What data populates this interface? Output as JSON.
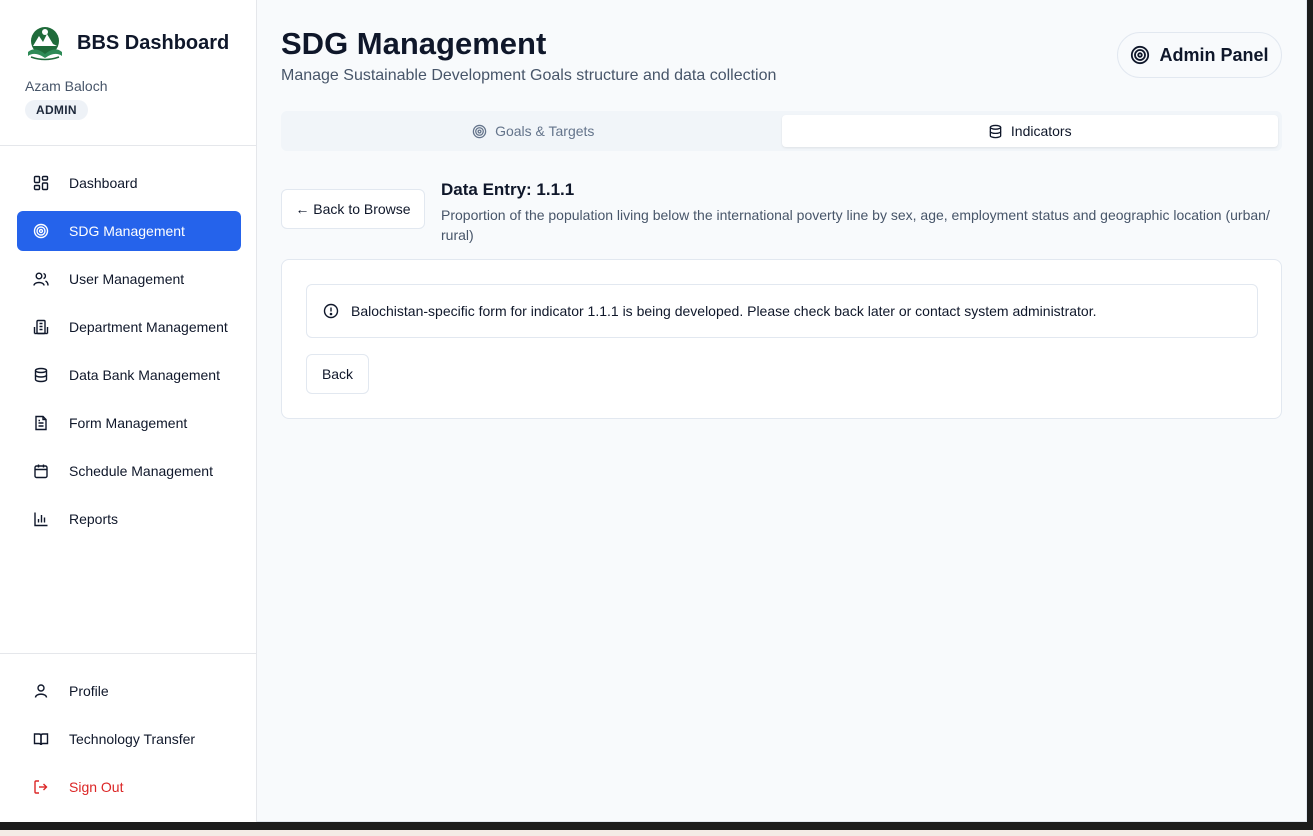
{
  "sidebar": {
    "brand": "BBS Dashboard",
    "user_name": "Azam Baloch",
    "role": "ADMIN",
    "nav": [
      {
        "label": "Dashboard",
        "icon": "grid-icon"
      },
      {
        "label": "SDG Management",
        "icon": "target-icon",
        "active": true
      },
      {
        "label": "User Management",
        "icon": "users-icon"
      },
      {
        "label": "Department Management",
        "icon": "building-icon"
      },
      {
        "label": "Data Bank Management",
        "icon": "database-icon"
      },
      {
        "label": "Form Management",
        "icon": "file-text-icon"
      },
      {
        "label": "Schedule Management",
        "icon": "calendar-icon"
      },
      {
        "label": "Reports",
        "icon": "bar-chart-icon"
      }
    ],
    "bottom_nav": [
      {
        "label": "Profile",
        "icon": "user-icon"
      },
      {
        "label": "Technology Transfer",
        "icon": "book-open-icon"
      },
      {
        "label": "Sign Out",
        "icon": "log-out-icon"
      }
    ]
  },
  "header": {
    "title": "SDG Management",
    "subtitle": "Manage Sustainable Development Goals structure and data collection",
    "admin_panel": "Admin Panel"
  },
  "tabs": [
    {
      "label": "Goals & Targets",
      "icon": "target-icon",
      "active": false
    },
    {
      "label": "Indicators",
      "icon": "database-icon",
      "active": true
    }
  ],
  "entry": {
    "back_label": "← Back to Browse",
    "title": "Data Entry: 1.1.1",
    "description": "Proportion of the population living below the international poverty line by sex, age, employment status and geographic location (urban/ rural)"
  },
  "card": {
    "alert": "Balochistan-specific form for indicator 1.1.1 is being developed. Please check back later or contact system administrator.",
    "back_button": "Back"
  },
  "colors": {
    "accent": "#2563eb",
    "danger": "#dc2626",
    "logo_green": "#1f6b3a"
  }
}
